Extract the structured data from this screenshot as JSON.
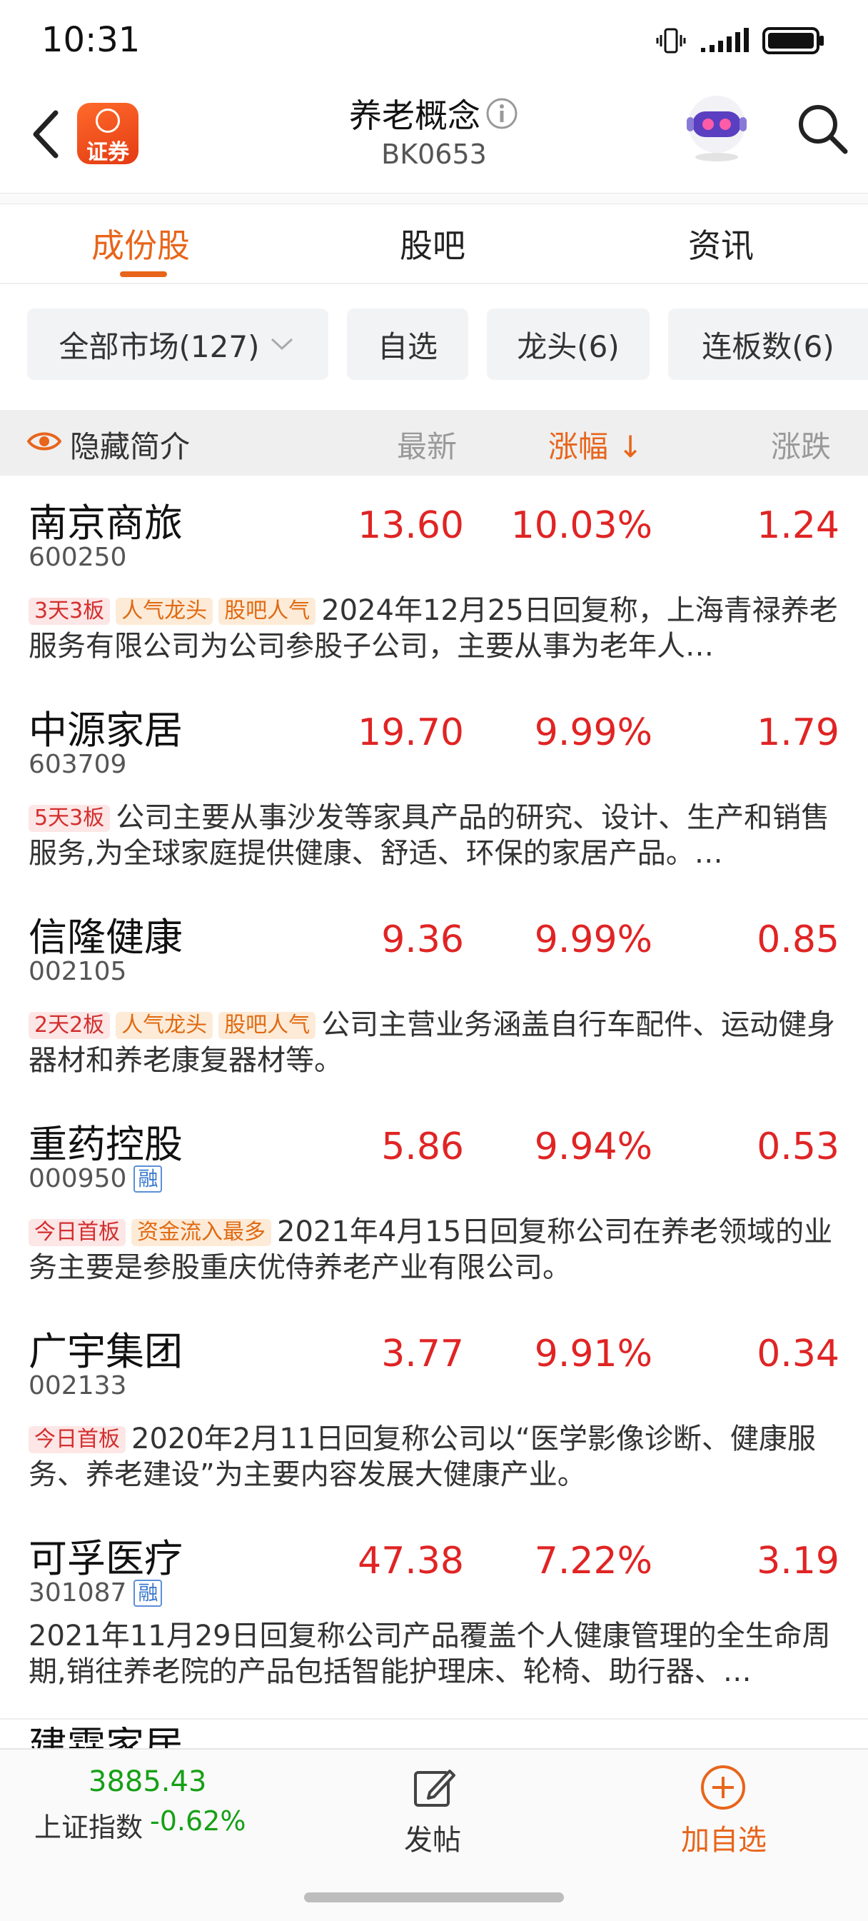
{
  "status_bar": {
    "time": "10:31"
  },
  "header": {
    "logo_text": "证券",
    "title": "养老概念",
    "code": "BK0653",
    "info_icon": "info-circle-icon",
    "assistant_icon": "robot-avatar-icon",
    "search_icon": "search-icon"
  },
  "tabs": [
    {
      "label": "成份股",
      "active": true
    },
    {
      "label": "股吧",
      "active": false
    },
    {
      "label": "资讯",
      "active": false
    }
  ],
  "filters": [
    {
      "label": "全部市场(127)"
    },
    {
      "label": "自选"
    },
    {
      "label": "龙头(6)"
    },
    {
      "label": "连板数(6)"
    }
  ],
  "columns": {
    "hide_intro": "隐藏简介",
    "latest": "最新",
    "change_pct": "涨幅",
    "sort_arrow": "↓",
    "change": "涨跌"
  },
  "stocks": [
    {
      "name": "南京商旅",
      "code": "600250",
      "margin": "",
      "price": "13.60",
      "pct": "10.03%",
      "chg": "1.24",
      "tags": [
        {
          "text": "3天3板",
          "style": "red"
        },
        {
          "text": "人气龙头",
          "style": "orange"
        },
        {
          "text": "股吧人气",
          "style": "orange"
        }
      ],
      "desc": "2024年12月25日回复称，上海青禄养老服务有限公司为公司参股子公司，主要从事为老年人…"
    },
    {
      "name": "中源家居",
      "code": "603709",
      "margin": "",
      "price": "19.70",
      "pct": "9.99%",
      "chg": "1.79",
      "tags": [
        {
          "text": "5天3板",
          "style": "red"
        }
      ],
      "desc": "公司主要从事沙发等家具产品的研究、设计、生产和销售服务,为全球家庭提供健康、舒适、环保的家居产品。…"
    },
    {
      "name": "信隆健康",
      "code": "002105",
      "margin": "",
      "price": "9.36",
      "pct": "9.99%",
      "chg": "0.85",
      "tags": [
        {
          "text": "2天2板",
          "style": "red"
        },
        {
          "text": "人气龙头",
          "style": "orange"
        },
        {
          "text": "股吧人气",
          "style": "orange"
        }
      ],
      "desc": "公司主营业务涵盖自行车配件、运动健身器材和养老康复器材等。"
    },
    {
      "name": "重药控股",
      "code": "000950",
      "margin": "融",
      "price": "5.86",
      "pct": "9.94%",
      "chg": "0.53",
      "tags": [
        {
          "text": "今日首板",
          "style": "red"
        },
        {
          "text": "资金流入最多",
          "style": "orange"
        }
      ],
      "desc": "2021年4月15日回复称公司在养老领域的业务主要是参股重庆优侍养老产业有限公司。"
    },
    {
      "name": "广宇集团",
      "code": "002133",
      "margin": "",
      "price": "3.77",
      "pct": "9.91%",
      "chg": "0.34",
      "tags": [
        {
          "text": "今日首板",
          "style": "red"
        }
      ],
      "desc": "2020年2月11日回复称公司以“医学影像诊断、健康服务、养老建设”为主要内容发展大健康产业。"
    },
    {
      "name": "可孚医疗",
      "code": "301087",
      "margin": "融",
      "price": "47.38",
      "pct": "7.22%",
      "chg": "3.19",
      "tags": [],
      "desc": "2021年11月29日回复称公司产品覆盖个人健康管理的全生命周期,销往养老院的产品包括智能护理床、轮椅、助行器、…"
    }
  ],
  "peek_row_name": "建霖家居",
  "bottom_bar": {
    "index_value": "3885.43",
    "index_name": "上证指数",
    "index_change": "-0.62%",
    "post_label": "发帖",
    "add_label": "加自选"
  },
  "colors": {
    "accent": "#e8651b",
    "up": "#e02424",
    "down": "#16a016"
  }
}
